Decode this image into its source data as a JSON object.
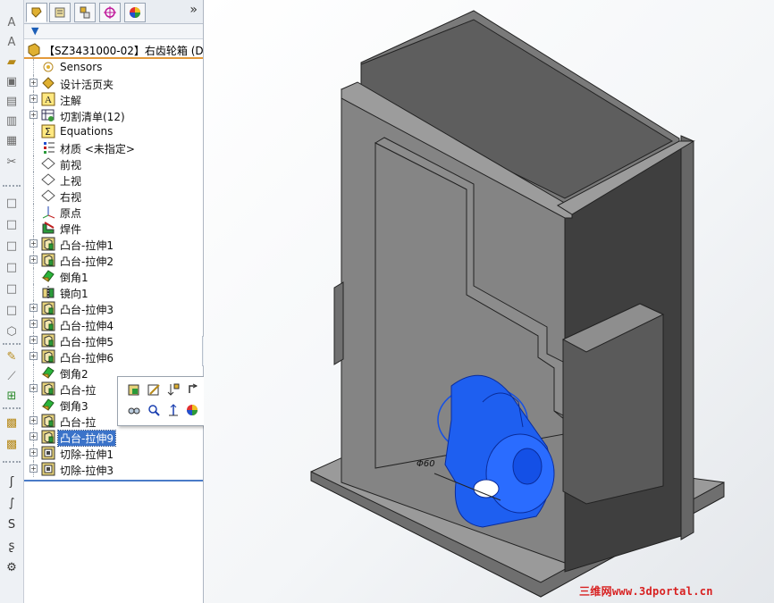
{
  "tabs": [
    {
      "name": "feature-manager",
      "icon": "feature-tree-icon",
      "active": true
    },
    {
      "name": "property-manager",
      "icon": "property-icon",
      "active": false
    },
    {
      "name": "configuration-manager",
      "icon": "configuration-icon",
      "active": false
    },
    {
      "name": "dimxpert-manager",
      "icon": "crosshair-icon",
      "active": false
    },
    {
      "name": "display-manager",
      "icon": "appearance-icon",
      "active": false
    }
  ],
  "tabs_more": "»",
  "root": {
    "label": "【SZ3431000-02】右齿轮箱  (D"
  },
  "tree": [
    {
      "label": "Sensors",
      "expander": false,
      "icon": "sensor-icon"
    },
    {
      "label": "设计活页夹",
      "expander": true,
      "icon": "design-binder-icon"
    },
    {
      "label": "注解",
      "expander": true,
      "icon": "annotation-icon"
    },
    {
      "label": "切割清单(12)",
      "expander": true,
      "icon": "cut-list-icon"
    },
    {
      "label": "Equations",
      "expander": false,
      "icon": "equations-icon"
    },
    {
      "label": "材质 <未指定>",
      "expander": false,
      "icon": "material-icon"
    },
    {
      "label": "前视",
      "expander": false,
      "icon": "plane-icon"
    },
    {
      "label": "上视",
      "expander": false,
      "icon": "plane-icon"
    },
    {
      "label": "右视",
      "expander": false,
      "icon": "plane-icon"
    },
    {
      "label": "原点",
      "expander": false,
      "icon": "origin-icon"
    },
    {
      "label": "焊件",
      "expander": false,
      "icon": "weldment-icon"
    },
    {
      "label": "凸台-拉伸1",
      "expander": true,
      "icon": "boss-extrude-icon"
    },
    {
      "label": "凸台-拉伸2",
      "expander": true,
      "icon": "boss-extrude-icon"
    },
    {
      "label": "倒角1",
      "expander": false,
      "icon": "chamfer-icon"
    },
    {
      "label": "镜向1",
      "expander": false,
      "icon": "mirror-icon"
    },
    {
      "label": "凸台-拉伸3",
      "expander": true,
      "icon": "boss-extrude-icon"
    },
    {
      "label": "凸台-拉伸4",
      "expander": true,
      "icon": "boss-extrude-icon"
    },
    {
      "label": "凸台-拉伸5",
      "expander": true,
      "icon": "boss-extrude-icon"
    },
    {
      "label": "凸台-拉伸6",
      "expander": true,
      "icon": "boss-extrude-icon"
    },
    {
      "label": "倒角2",
      "expander": false,
      "icon": "chamfer-icon"
    },
    {
      "label": "凸台-拉",
      "expander": true,
      "icon": "boss-extrude-icon"
    },
    {
      "label": "倒角3",
      "expander": false,
      "icon": "chamfer-icon"
    },
    {
      "label": "凸台-拉",
      "expander": true,
      "icon": "boss-extrude-icon"
    },
    {
      "label": "凸台-拉伸9",
      "expander": true,
      "icon": "boss-extrude-icon",
      "selected": true
    },
    {
      "label": "切除-拉伸1",
      "expander": true,
      "icon": "cut-extrude-icon"
    },
    {
      "label": "切除-拉伸3",
      "expander": true,
      "icon": "cut-extrude-icon"
    }
  ],
  "context_toolbar": [
    {
      "name": "edit-feature-button",
      "icon": "edit-feature-icon"
    },
    {
      "name": "edit-sketch-button",
      "icon": "edit-sketch-icon"
    },
    {
      "name": "rollback-button",
      "icon": "rollback-icon"
    },
    {
      "name": "parent-child-button",
      "icon": "parent-child-icon"
    },
    {
      "name": "hide-show-button",
      "icon": "glasses-icon"
    },
    {
      "name": "zoom-to-selection-button",
      "icon": "zoom-icon"
    },
    {
      "name": "normal-to-button",
      "icon": "normal-to-icon"
    },
    {
      "name": "appearance-button",
      "icon": "appearance-icon"
    }
  ],
  "viewport": {
    "dimension_label": "Φ60",
    "model_color": "#808080",
    "selected_color": "#1450e6"
  },
  "watermark": "三维网www.3dportal.cn",
  "colors": {
    "selection": "#3b73c9",
    "root_underline": "#e39a3a"
  }
}
